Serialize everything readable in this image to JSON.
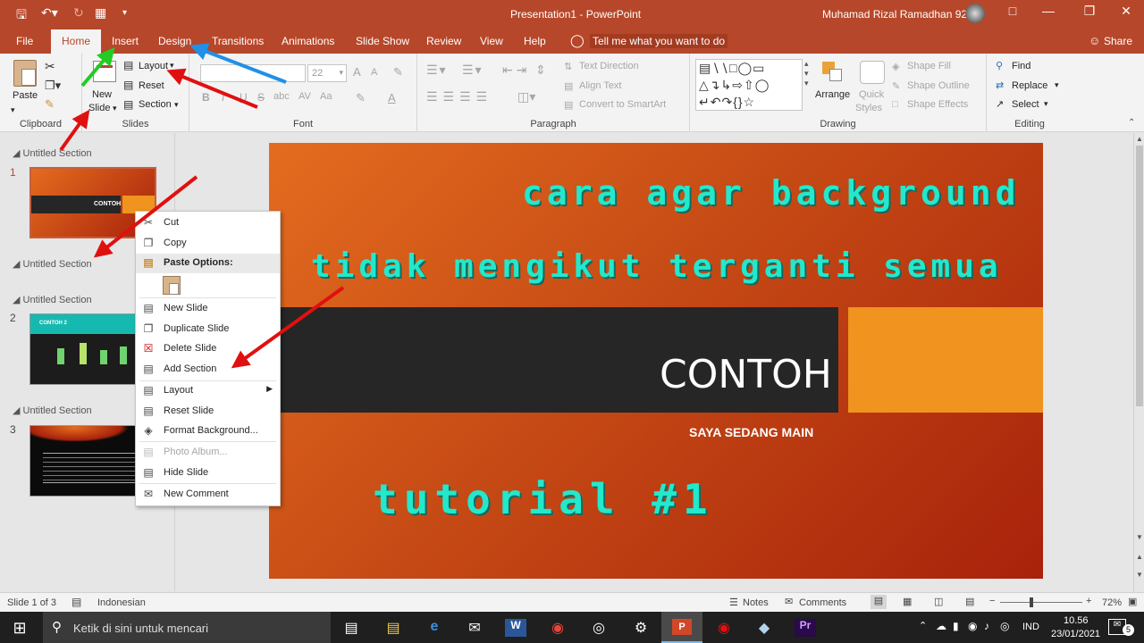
{
  "window": {
    "title": "Presentation1  -  PowerPoint",
    "user": "Muhamad Rizal Ramadhan 92"
  },
  "tabs": [
    "File",
    "Home",
    "Insert",
    "Design",
    "Transitions",
    "Animations",
    "Slide Show",
    "Review",
    "View",
    "Help"
  ],
  "tell_me": "Tell me what you want to do",
  "share": "Share",
  "ribbon": {
    "clipboard": {
      "paste": "Paste",
      "label": "Clipboard"
    },
    "slides": {
      "new_slide_1": "New",
      "new_slide_2": "Slide",
      "layout": "Layout",
      "reset": "Reset",
      "section": "Section",
      "label": "Slides"
    },
    "font": {
      "size": "22",
      "label": "Font",
      "bold": "B",
      "italic": "I",
      "underline": "U",
      "strike": "S",
      "shadow": "abc",
      "spacing": "AV",
      "case": "Aa",
      "grow": "A",
      "shrink": "A"
    },
    "paragraph": {
      "text_direction": "Text Direction",
      "align_text": "Align Text",
      "smartart": "Convert to SmartArt",
      "label": "Paragraph"
    },
    "drawing": {
      "arrange": "Arrange",
      "quick_styles_1": "Quick",
      "quick_styles_2": "Styles",
      "shape_fill": "Shape Fill",
      "shape_outline": "Shape Outline",
      "shape_effects": "Shape Effects",
      "label": "Drawing"
    },
    "editing": {
      "find": "Find",
      "replace": "Replace",
      "select": "Select",
      "label": "Editing"
    }
  },
  "thumbnails": {
    "sections": [
      "Untitled Section",
      "Untitled Section",
      "Untitled Section",
      "Untitled Section"
    ],
    "numbers": [
      "1",
      "2",
      "3"
    ],
    "thumb1_title": "CONTOH",
    "thumb2_title": "CONTOH 2"
  },
  "slide": {
    "line1": "cara agar background",
    "line2": "tidak mengikut terganti semua",
    "title": "CONTOH",
    "subtitle": "SAYA SEDANG MAIN",
    "line3": "tutorial #1"
  },
  "context_menu": {
    "cut": "Cut",
    "copy": "Copy",
    "paste_options": "Paste Options:",
    "new_slide": "New Slide",
    "duplicate_slide": "Duplicate Slide",
    "delete_slide": "Delete Slide",
    "add_section": "Add Section",
    "layout": "Layout",
    "reset_slide": "Reset Slide",
    "format_background": "Format Background...",
    "photo_album": "Photo Album...",
    "hide_slide": "Hide Slide",
    "new_comment": "New Comment"
  },
  "status": {
    "slide": "Slide 1 of 3",
    "language": "Indonesian",
    "notes": "Notes",
    "comments": "Comments",
    "zoom": "72%"
  },
  "taskbar": {
    "search": "Ketik di sini untuk mencari",
    "lang": "IND",
    "time": "10.56",
    "date": "23/01/2021",
    "notif": "5"
  },
  "colors": {
    "accent": "#b7472a",
    "teal_text": "#23e8cc",
    "arrow_red": "#e01010",
    "arrow_green": "#22cc22",
    "arrow_blue": "#2090e8"
  }
}
